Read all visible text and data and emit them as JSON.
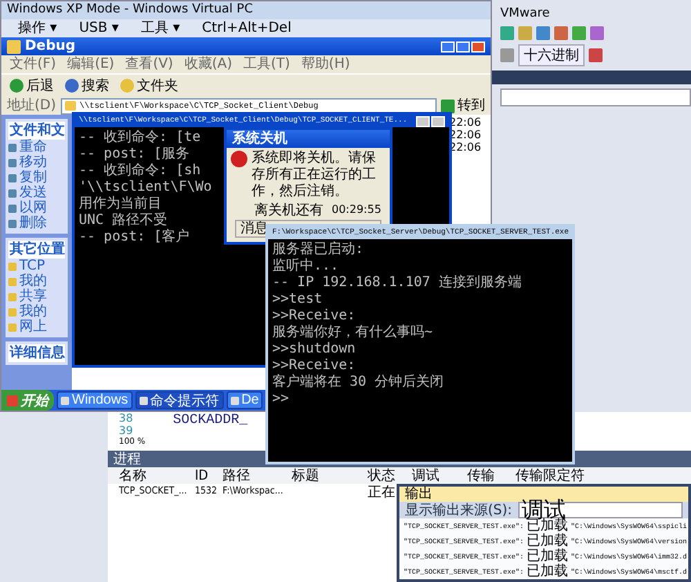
{
  "vs": {
    "menu": [
      "VMware"
    ],
    "toolbar_button": "十六进制",
    "editor": {
      "line_numbers": [
        "38",
        "39"
      ],
      "code": "SOCKADDR_",
      "zoom": "100 %"
    },
    "processes": {
      "title": "进程",
      "columns": [
        "名称",
        "ID",
        "路径",
        "标题",
        "状态",
        "调试",
        "传输",
        "传输限定符"
      ],
      "rows": [
        {
          "cells": [
            "TCP_SOCKET_...",
            "1532",
            "F:\\Workspac...",
            "",
            "正在"
          ],
          "selected": false
        }
      ]
    },
    "output": {
      "title": "输出",
      "source_label": "显示输出来源(S):",
      "source": "调试",
      "lines": [
        {
          "exe": "\"TCP_SOCKET_SERVER_TEST.exe\":",
          "status": "已加载",
          "path": "\"C:\\Windows\\SysWOW64\\sspicli"
        },
        {
          "exe": "\"TCP_SOCKET_SERVER_TEST.exe\":",
          "status": "已加载",
          "path": "\"C:\\Windows\\SysWOW64\\version"
        },
        {
          "exe": "\"TCP_SOCKET_SERVER_TEST.exe\":",
          "status": "已加载",
          "path": "\"C:\\Windows\\SysWOW64\\imm32.d"
        },
        {
          "exe": "\"TCP_SOCKET_SERVER_TEST.exe\":",
          "status": "已加载",
          "path": "\"C:\\Windows\\SysWOW64\\msctf.d"
        }
      ]
    }
  },
  "xp_window": {
    "title": "Windows XP Mode - Windows Virtual PC",
    "menu": [
      "操作 ▾",
      "USB ▾",
      "工具 ▾",
      "Ctrl+Alt+Del"
    ],
    "explorer": {
      "title": "Debug",
      "menu": [
        "文件(F)",
        "编辑(E)",
        "查看(V)",
        "收藏(A)",
        "工具(T)",
        "帮助(H)"
      ],
      "toolbar": [
        "后退",
        "搜索",
        "文件夹"
      ],
      "address_label": "地址(D)",
      "address": "\\\\tsclient\\F\\Workspace\\C\\TCP_Socket_Client\\Debug",
      "go": "转到",
      "task_heading": "文件和文",
      "tasks": [
        "重命",
        "移动",
        "复制",
        "发送",
        "以网",
        "删除"
      ],
      "places_heading": "其它位置",
      "places": [
        "TCP",
        "我的",
        "共享",
        "我的",
        "网上"
      ],
      "details_heading": "详细信息",
      "times": [
        "22:06",
        "22:06",
        "22:06"
      ]
    },
    "client_console": {
      "title": "\\\\tsclient\\F\\Workspace\\C\\TCP_Socket_Client\\Debug\\TCP_SOCKET_CLIENT_TE...",
      "lines": [
        "-- 收到命令: [te",
        "-- post: [服务",
        "-- 收到命令: [sh",
        "'\\\\tsclient\\F\\Wo",
        "用作为当前目",
        "UNC 路径不受",
        "-- post: [客户"
      ]
    },
    "dialog": {
      "title": "系统关机",
      "message": "系统即将关机。请保存所有正在运行的工作，然后注销。",
      "countdown_label": "离关机还有",
      "countdown": "00:29:55",
      "group": "消息"
    },
    "taskbar": {
      "start": "开始",
      "items": [
        {
          "label": "Windows",
          "selected": false
        },
        {
          "label": "命令提示符",
          "selected": true
        },
        {
          "label": "De",
          "selected": false
        }
      ]
    }
  },
  "server_console": {
    "title": "F:\\Workspace\\C\\TCP_Socket_Server\\Debug\\TCP_SOCKET_SERVER_TEST.exe",
    "lines": [
      "服务器已启动:",
      "监听中...",
      "-- IP 192.168.1.107 连接到服务端",
      ">>test",
      ">>Receive:",
      "服务端你好，有什么事吗~",
      ">>shutdown",
      ">>Receive:",
      "客户端将在 30 分钟后关闭",
      ">>"
    ]
  }
}
